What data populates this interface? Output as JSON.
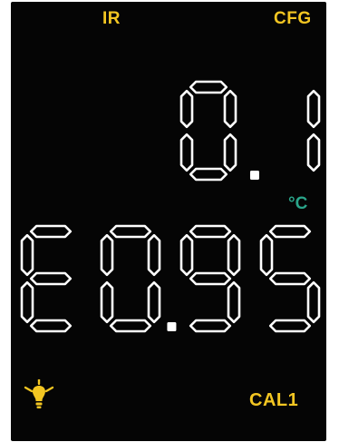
{
  "header": {
    "mode_label": "IR",
    "config_label": "CFG"
  },
  "temperature": {
    "value": "0.1",
    "unit": "°C"
  },
  "emissivity": {
    "value": "E0.95"
  },
  "footer": {
    "light_icon": "lightbulb-icon",
    "calibration_label": "CAL1"
  },
  "colors": {
    "background": "#050505",
    "digits": "#ffffff",
    "indicator": "#f3c622",
    "unit": "#2aa58a"
  }
}
